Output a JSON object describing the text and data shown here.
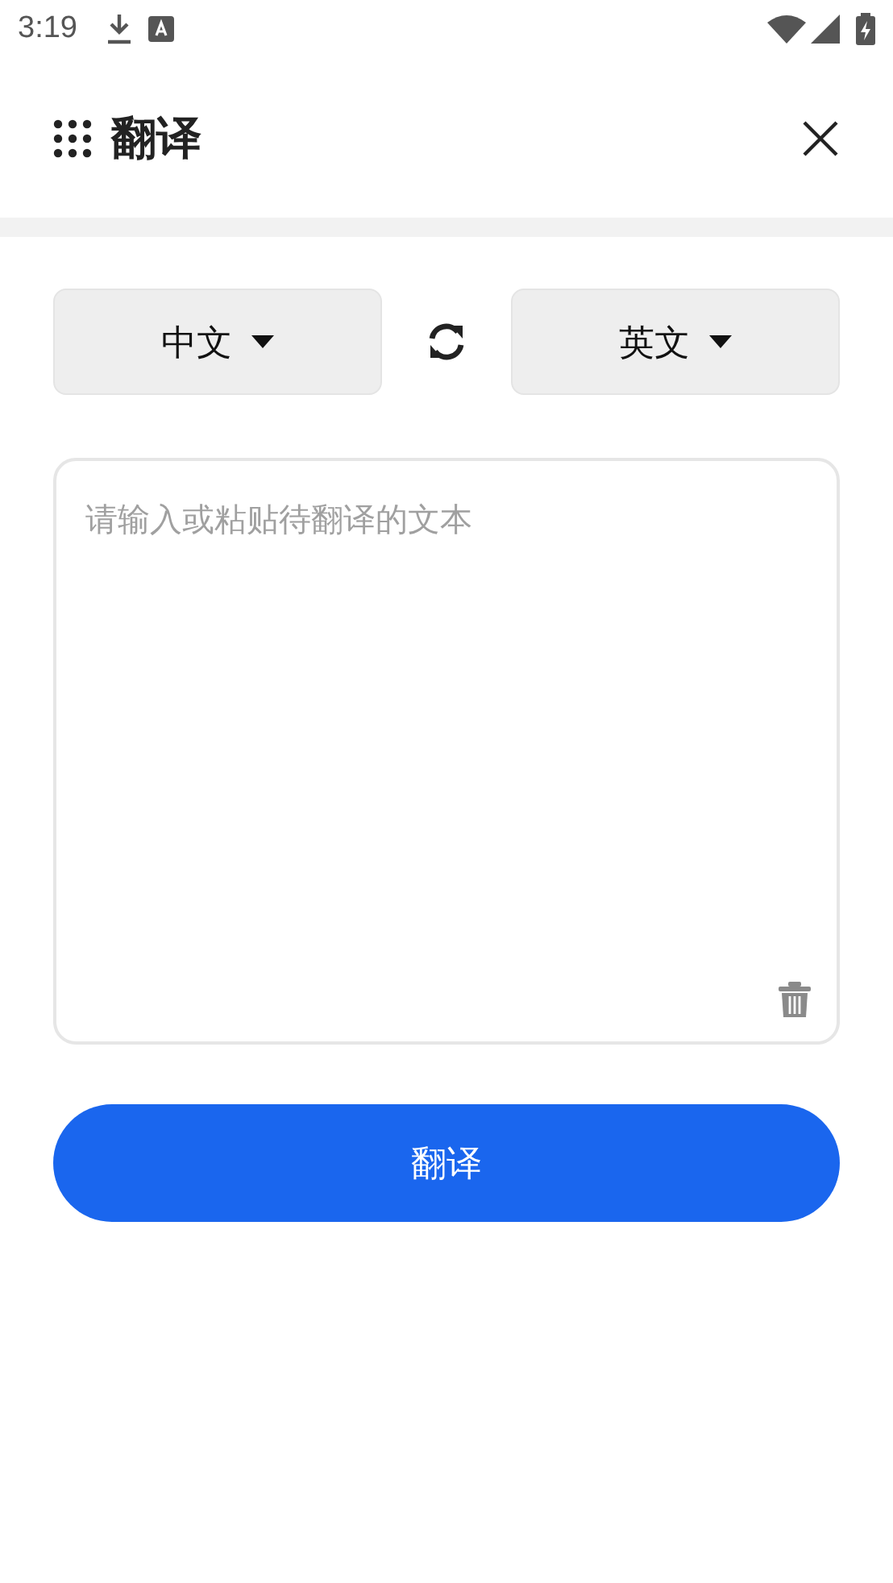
{
  "status_bar": {
    "time": "3:19"
  },
  "header": {
    "title": "翻译"
  },
  "languages": {
    "source": "中文",
    "target": "英文"
  },
  "input": {
    "placeholder": "请输入或粘贴待翻译的文本"
  },
  "translate_button": {
    "label": "翻译"
  }
}
